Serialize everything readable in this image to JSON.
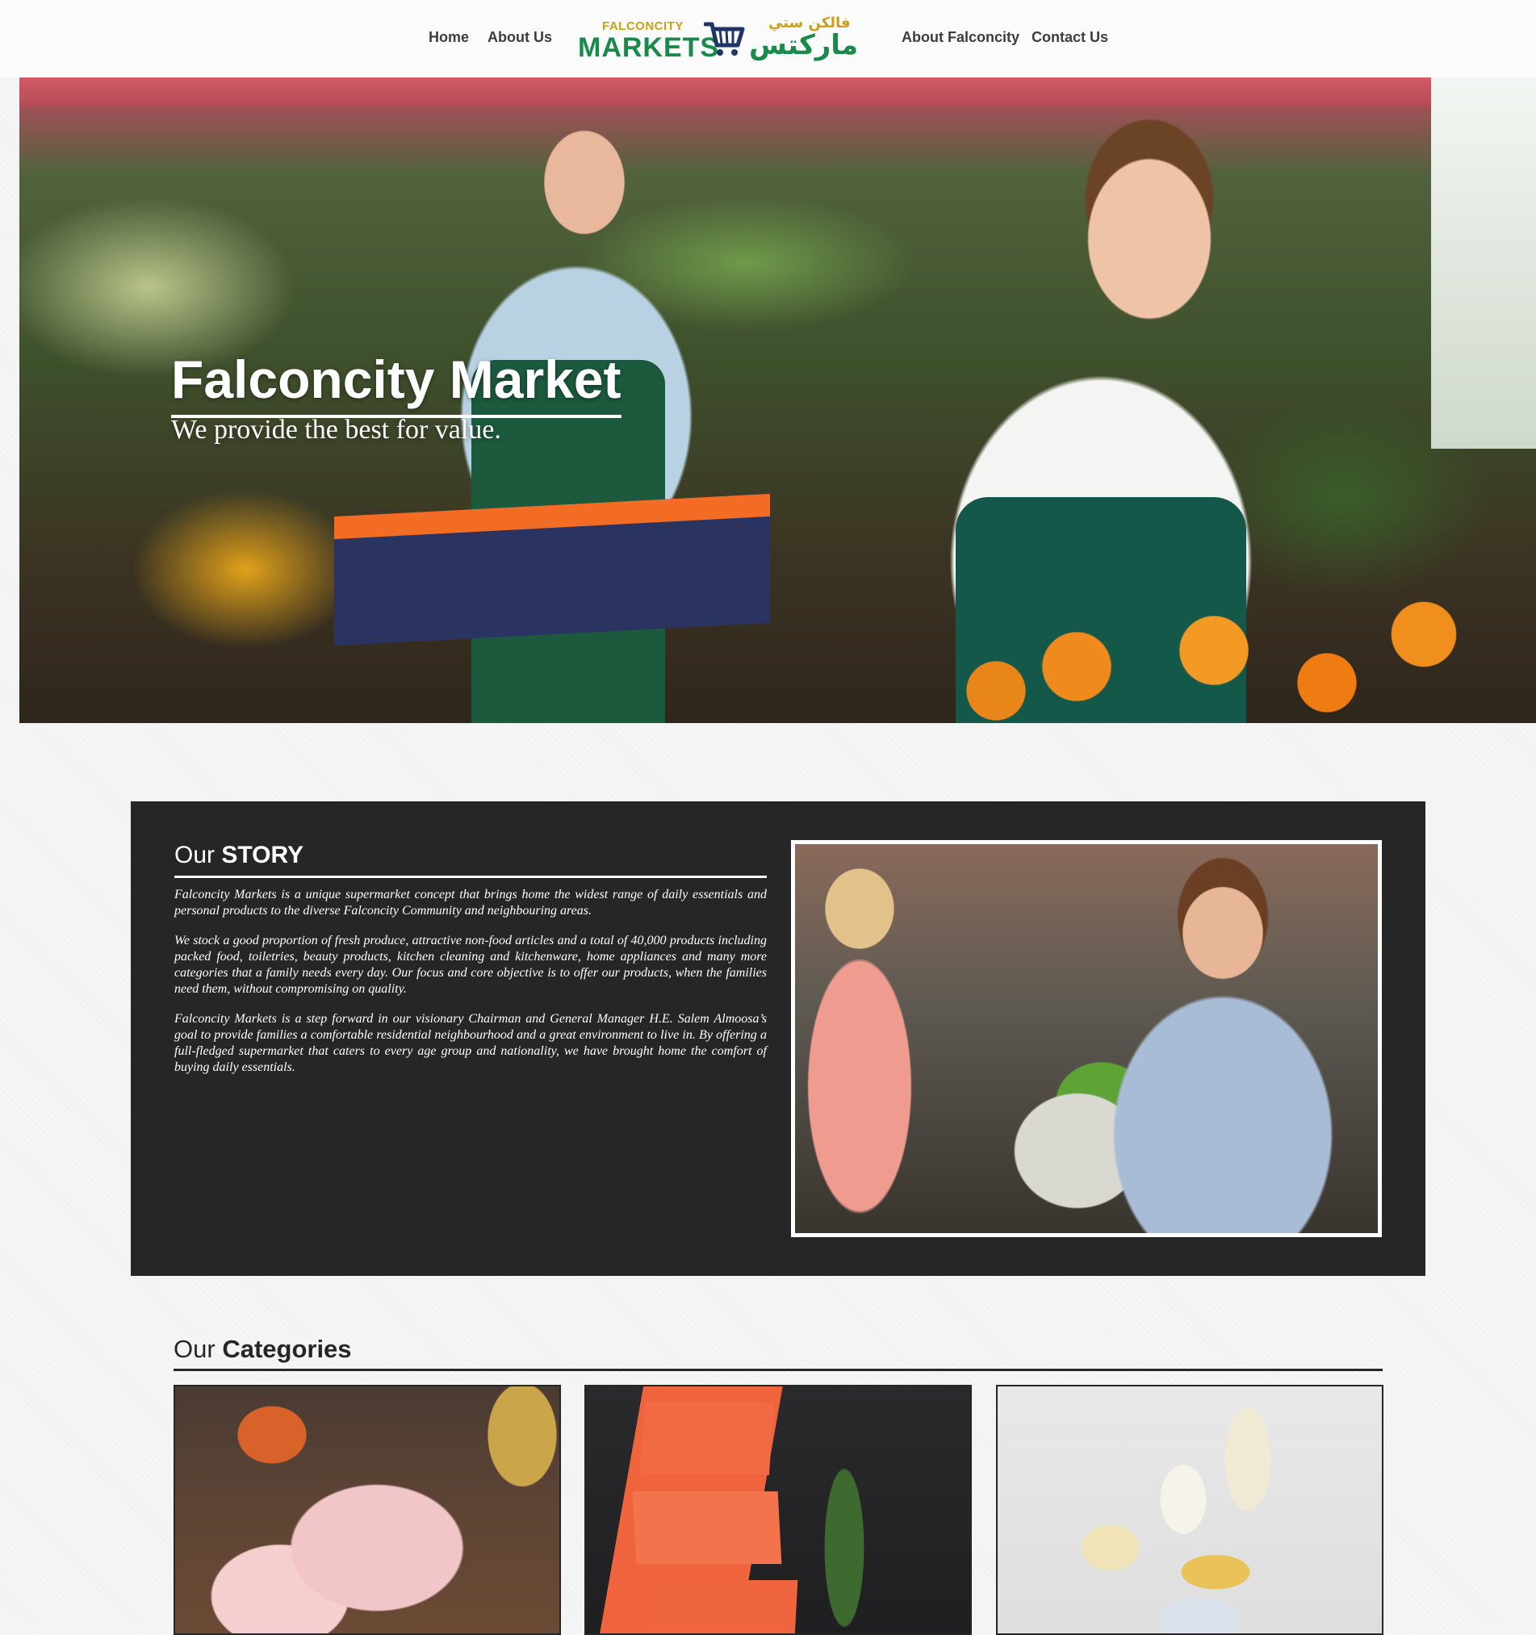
{
  "nav": {
    "home": "Home",
    "about_us": "About Us",
    "about_falconcity": "About Falconcity",
    "contact_us": "Contact Us"
  },
  "logo": {
    "small_en": "FALCONCITY",
    "big_en": "MARKETS",
    "small_ar": "فالكن ستي",
    "big_ar": "ماركتس"
  },
  "hero": {
    "title": "Falconcity Market",
    "subtitle": "We provide the best for value."
  },
  "story": {
    "heading_light": "Our",
    "heading_bold": "STORY",
    "paragraphs": [
      "Falconcity Markets is a unique supermarket concept that brings home the widest range of daily essentials and personal products to the diverse Falconcity Community and neighbouring areas.",
      "We stock a good proportion of fresh produce, attractive non-food articles and a total of 40,000 products including packed food, toiletries, beauty products, kitchen cleaning and kitchenware, home appliances and many more categories that a family needs every day. Our focus and core objective is to offer our products, when the families need them, without compromising on quality.",
      "Falconcity Markets is a step forward in our visionary Chairman and General Manager H.E. Salem Almoosa’s goal to provide families a comfortable residential neighbourhood and a great environment to live in. By offering a full-fledged supermarket that caters to every age group and nationality, we have brought home the comfort of buying daily essentials."
    ]
  },
  "categories": {
    "heading_light": "Our",
    "heading_bold": "Categories"
  },
  "colors": {
    "brand_green": "#1a8a4c",
    "brand_gold": "#c8a117",
    "story_bg": "#262626"
  }
}
